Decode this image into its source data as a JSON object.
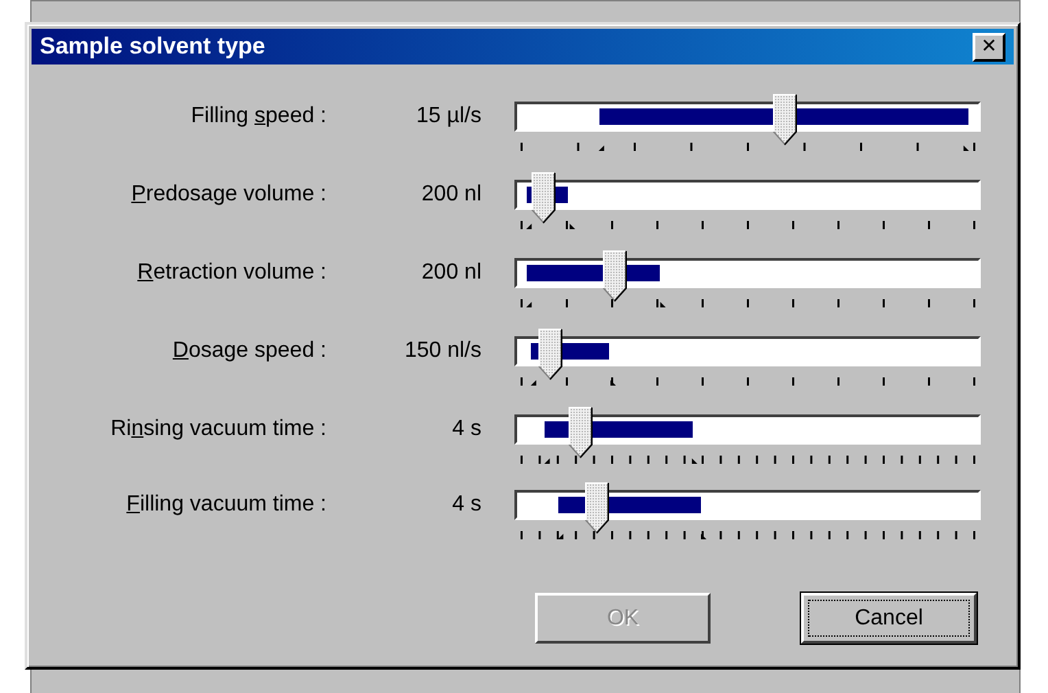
{
  "window": {
    "title": "Sample solvent type",
    "close_icon": "✕"
  },
  "sliders": [
    {
      "label": {
        "before": "Filling ",
        "key": "s",
        "after": "peed :"
      },
      "value": "15 µl/s",
      "kind": "sparse",
      "level": 0.58,
      "selection_start": {
        "level": 0.18
      },
      "selection_end": {
        "level": 0.98
      }
    },
    {
      "label": {
        "key": "P",
        "after": "redosage volume :"
      },
      "value": "200 nl",
      "kind": "medium",
      "level": 0.055,
      "selection_start": {
        "level": 0.02
      },
      "selection_end": {
        "level": 0.11
      }
    },
    {
      "label": {
        "key": "R",
        "after": "etraction volume :"
      },
      "value": "200 nl",
      "kind": "medium",
      "level": 0.21,
      "selection_start": {
        "level": 0.02
      },
      "selection_end": {
        "level": 0.31
      }
    },
    {
      "label": {
        "key": "D",
        "after": "osage speed :"
      },
      "value": "150 nl/s",
      "kind": "medium",
      "level": 0.07,
      "selection_start": {
        "level": 0.03
      },
      "selection_end": {
        "level": 0.2
      }
    },
    {
      "label": {
        "before": "Ri",
        "key": "n",
        "after": "sing vacuum time :"
      },
      "value": "4 s",
      "kind": "fine",
      "level": 0.135,
      "selection_start": {
        "level": 0.06
      },
      "selection_end": {
        "level": 0.38
      }
    },
    {
      "label": {
        "key": "F",
        "after": "illing vacuum time :"
      },
      "value": "4 s",
      "kind": "fine",
      "level": 0.17,
      "selection_start": {
        "level": 0.09
      },
      "selection_end": {
        "level": 0.4
      }
    }
  ],
  "buttons": [
    {
      "label": "OK",
      "disabled": true,
      "default": false
    },
    {
      "label": "Cancel",
      "disabled": false,
      "default": true
    }
  ]
}
